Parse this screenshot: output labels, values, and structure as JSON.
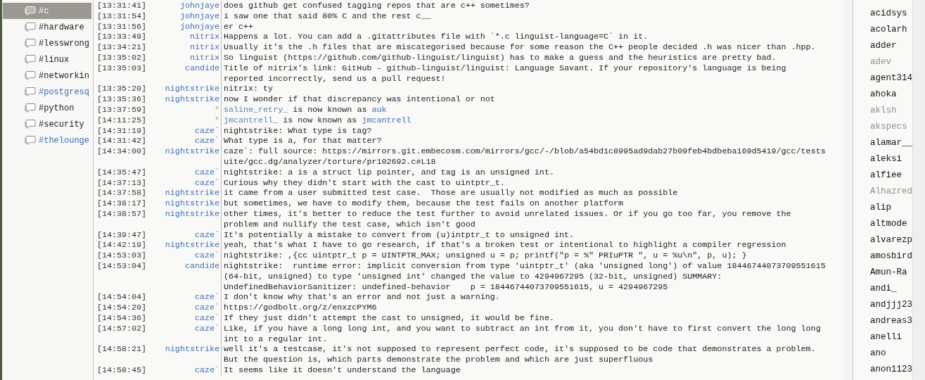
{
  "channels": [
    {
      "name": "#c",
      "selected": true,
      "color": "#ffffff"
    },
    {
      "name": "#hardware",
      "selected": false,
      "color": "#1a1a1a"
    },
    {
      "name": "#lesswrong",
      "selected": false,
      "color": "#1a1a1a"
    },
    {
      "name": "#linux",
      "selected": false,
      "color": "#1a1a1a"
    },
    {
      "name": "#networkin",
      "selected": false,
      "color": "#1a1a1a"
    },
    {
      "name": "#postgresq",
      "selected": false,
      "color": "#3d6db5"
    },
    {
      "name": "#python",
      "selected": false,
      "color": "#1a1a1a"
    },
    {
      "name": "#security",
      "selected": false,
      "color": "#1a1a1a"
    },
    {
      "name": "#thelounge",
      "selected": false,
      "color": "#3d6db5"
    }
  ],
  "messages": [
    {
      "kind": "message",
      "time": "[13:31:41]",
      "nick": "johnjaye",
      "text": "does github get confused tagging repos that are c++ sometimes?"
    },
    {
      "kind": "message",
      "time": "[13:31:54]",
      "nick": "johnjaye",
      "text": "i saw one that said 80% C and the rest c__"
    },
    {
      "kind": "message",
      "time": "[13:31:56]",
      "nick": "johnjaye",
      "text": "er c++"
    },
    {
      "kind": "message",
      "time": "[13:33:49]",
      "nick": "nitrix",
      "text": "Happens a lot. You can add a .gitattributes file with `*.c linguist-language=C` in it."
    },
    {
      "kind": "message",
      "time": "[13:34:21]",
      "nick": "nitrix",
      "text": "Usually it's the .h files that are miscategorised because for some reason the C++ people decided .h was nicer than .hpp."
    },
    {
      "kind": "message",
      "time": "[13:35:02]",
      "nick": "nitrix",
      "text": "So linguist (https://github.com/github-linguist/linguist) has to make a guess and the heuristics are pretty bad."
    },
    {
      "kind": "message",
      "time": "[13:35:03]",
      "nick": "candide",
      "text": "Title of nitrix's link: GitHub - github-linguist/linguist: Language Savant. If your repository's language is being reported incorrectly, send us a pull request!"
    },
    {
      "kind": "message",
      "time": "[13:35:20]",
      "nick": "nightstrike",
      "text": "nitrix: ty"
    },
    {
      "kind": "message",
      "time": "[13:35:36]",
      "nick": "nightstrike",
      "text": "now I wonder if that discrepancy was intentional or not"
    },
    {
      "kind": "nick_change",
      "time": "[13:37:59]",
      "nick": "*",
      "old": "saline_retry_",
      "text": "is now known as",
      "new": "auk"
    },
    {
      "kind": "nick_change",
      "time": "[14:11:25]",
      "nick": "*",
      "old": "jmcantrell_",
      "text": "is now known as",
      "new": "jmcantrell"
    },
    {
      "kind": "message",
      "time": "[14:31:19]",
      "nick": "caze`",
      "text": "nightstrike: What type is tag?"
    },
    {
      "kind": "message",
      "time": "[14:31:42]",
      "nick": "caze`",
      "text": "What type is a, for that matter?"
    },
    {
      "kind": "message",
      "time": "[14:34:00]",
      "nick": "nightstrike",
      "text": "caze`: full source: ",
      "link": "https://mirrors.git.embecosm.com/mirrors/gcc/-/blob/a54bd1c8995ad9dab27b09feb4bdbeba169d5419/gcc/testsuite/gcc.dg/analyzer/torture/pr102692.c#L18"
    },
    {
      "kind": "message",
      "time": "[14:35:47]",
      "nick": "caze`",
      "text": "nightstrike: a is a struct lip pointer, and tag is an unsigned int."
    },
    {
      "kind": "message",
      "time": "[14:37:13]",
      "nick": "caze`",
      "text": "Curious why they didn't start with the cast to uintptr_t."
    },
    {
      "kind": "message",
      "time": "[14:37:58]",
      "nick": "nightstrike",
      "text": "it came from a user submitted test case.  Those are usually not modified as much as possible"
    },
    {
      "kind": "message",
      "time": "[14:38:17]",
      "nick": "nightstrike",
      "text": "but sometimes, we have to modify them, because the test fails on another platform"
    },
    {
      "kind": "message",
      "time": "[14:38:57]",
      "nick": "nightstrike",
      "text": "other times, it's better to reduce the test further to avoid unrelated issues. Or if you go too far, you remove the problem and nullify the test case, which isn't good"
    },
    {
      "kind": "message",
      "time": "[14:39:47]",
      "nick": "caze`",
      "text": "It's potentially a mistake to convert from (u)intptr_t to unsigned int."
    },
    {
      "kind": "message",
      "time": "[14:42:19]",
      "nick": "nightstrike",
      "text": "yeah, that's what I have to go research, if that's a broken test or intentional to highlight a compiler regression"
    },
    {
      "kind": "message",
      "time": "[14:53:03]",
      "nick": "caze`",
      "text": "nightstrike: ,{cc uintptr_t p = UINTPTR_MAX; unsigned u = p; printf(\"p = %\" PRIuPTR \", u = %u\\n\", p, u); }"
    },
    {
      "kind": "message",
      "time": "[14:53:04]",
      "nick": "candide",
      "text": "nightstrike:  runtime error: implicit conversion from type 'uintptr_t' (aka 'unsigned long') of value 18446744073709551615 (64-bit, unsigned) to type 'unsigned int' changed the value to 4294967295 (32-bit, unsigned) SUMMARY: UndefinedBehaviorSanitizer: undefined-behavior    p = 18446744073709551615, u = 4294967295"
    },
    {
      "kind": "message",
      "time": "[14:54:04]",
      "nick": "caze`",
      "text": "I don't know why that's an error and not just a warning."
    },
    {
      "kind": "message",
      "time": "[14:54:20]",
      "nick": "caze`",
      "text": "https://godbolt.org/z/enxzcPYM6"
    },
    {
      "kind": "message",
      "time": "[14:54:36]",
      "nick": "caze`",
      "text": "If they just didn't attempt the cast to unsigned, it would be fine."
    },
    {
      "kind": "message",
      "time": "[14:57:02]",
      "nick": "caze`",
      "text": "Like, if you have a long long int, and you want to subtract an int from it, you don't have to first convert the long long int to a regular int."
    },
    {
      "kind": "message",
      "time": "[14:58:21]",
      "nick": "nightstrike",
      "text": "well it's a testcase, it's not supposed to represent perfect code, it's supposed to be code that demonstrates a problem. But the question is, which parts demonstrate the problem and which are just superfluous"
    },
    {
      "kind": "message",
      "time": "[14:58:45]",
      "nick": "caze`",
      "text": "It seems like it doesn't understand the language"
    }
  ],
  "users": [
    {
      "name": "acidsys",
      "away": false
    },
    {
      "name": "acolarh",
      "away": false
    },
    {
      "name": "adder",
      "away": false
    },
    {
      "name": "adev",
      "away": true
    },
    {
      "name": "agent314",
      "away": false
    },
    {
      "name": "ahoka",
      "away": false
    },
    {
      "name": "aklsh",
      "away": true
    },
    {
      "name": "akspecs",
      "away": true
    },
    {
      "name": "alamar__",
      "away": false
    },
    {
      "name": "aleksi",
      "away": false
    },
    {
      "name": "alfiee",
      "away": false
    },
    {
      "name": "Alhazred",
      "away": true
    },
    {
      "name": "alip",
      "away": false
    },
    {
      "name": "altmode",
      "away": false
    },
    {
      "name": "alvarezp",
      "away": false
    },
    {
      "name": "amosbird",
      "away": false
    },
    {
      "name": "Amun-Ra",
      "away": false
    },
    {
      "name": "andi_",
      "away": false
    },
    {
      "name": "andjjj23",
      "away": false
    },
    {
      "name": "andreas3",
      "away": false
    },
    {
      "name": "anelli",
      "away": false
    },
    {
      "name": "ano",
      "away": false
    },
    {
      "name": "anon1123",
      "away": false
    }
  ]
}
